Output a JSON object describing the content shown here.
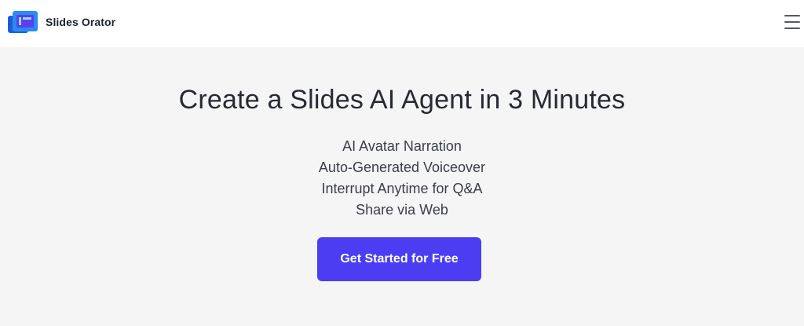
{
  "header": {
    "brand_name": "Slides Orator",
    "logo_icon": "slides-logo-icon",
    "menu_icon": "hamburger-menu-icon"
  },
  "hero": {
    "title": "Create a Slides AI Agent in 3 Minutes",
    "features": [
      "AI Avatar Narration",
      "Auto-Generated Voiceover",
      "Interrupt Anytime for Q&A",
      "Share via Web"
    ],
    "cta_label": "Get Started for Free"
  },
  "colors": {
    "brand_primary": "#4b3ef2",
    "logo_blue": "#2a8cf0",
    "hero_background": "#f5f5f6",
    "title_text": "#262a33"
  }
}
